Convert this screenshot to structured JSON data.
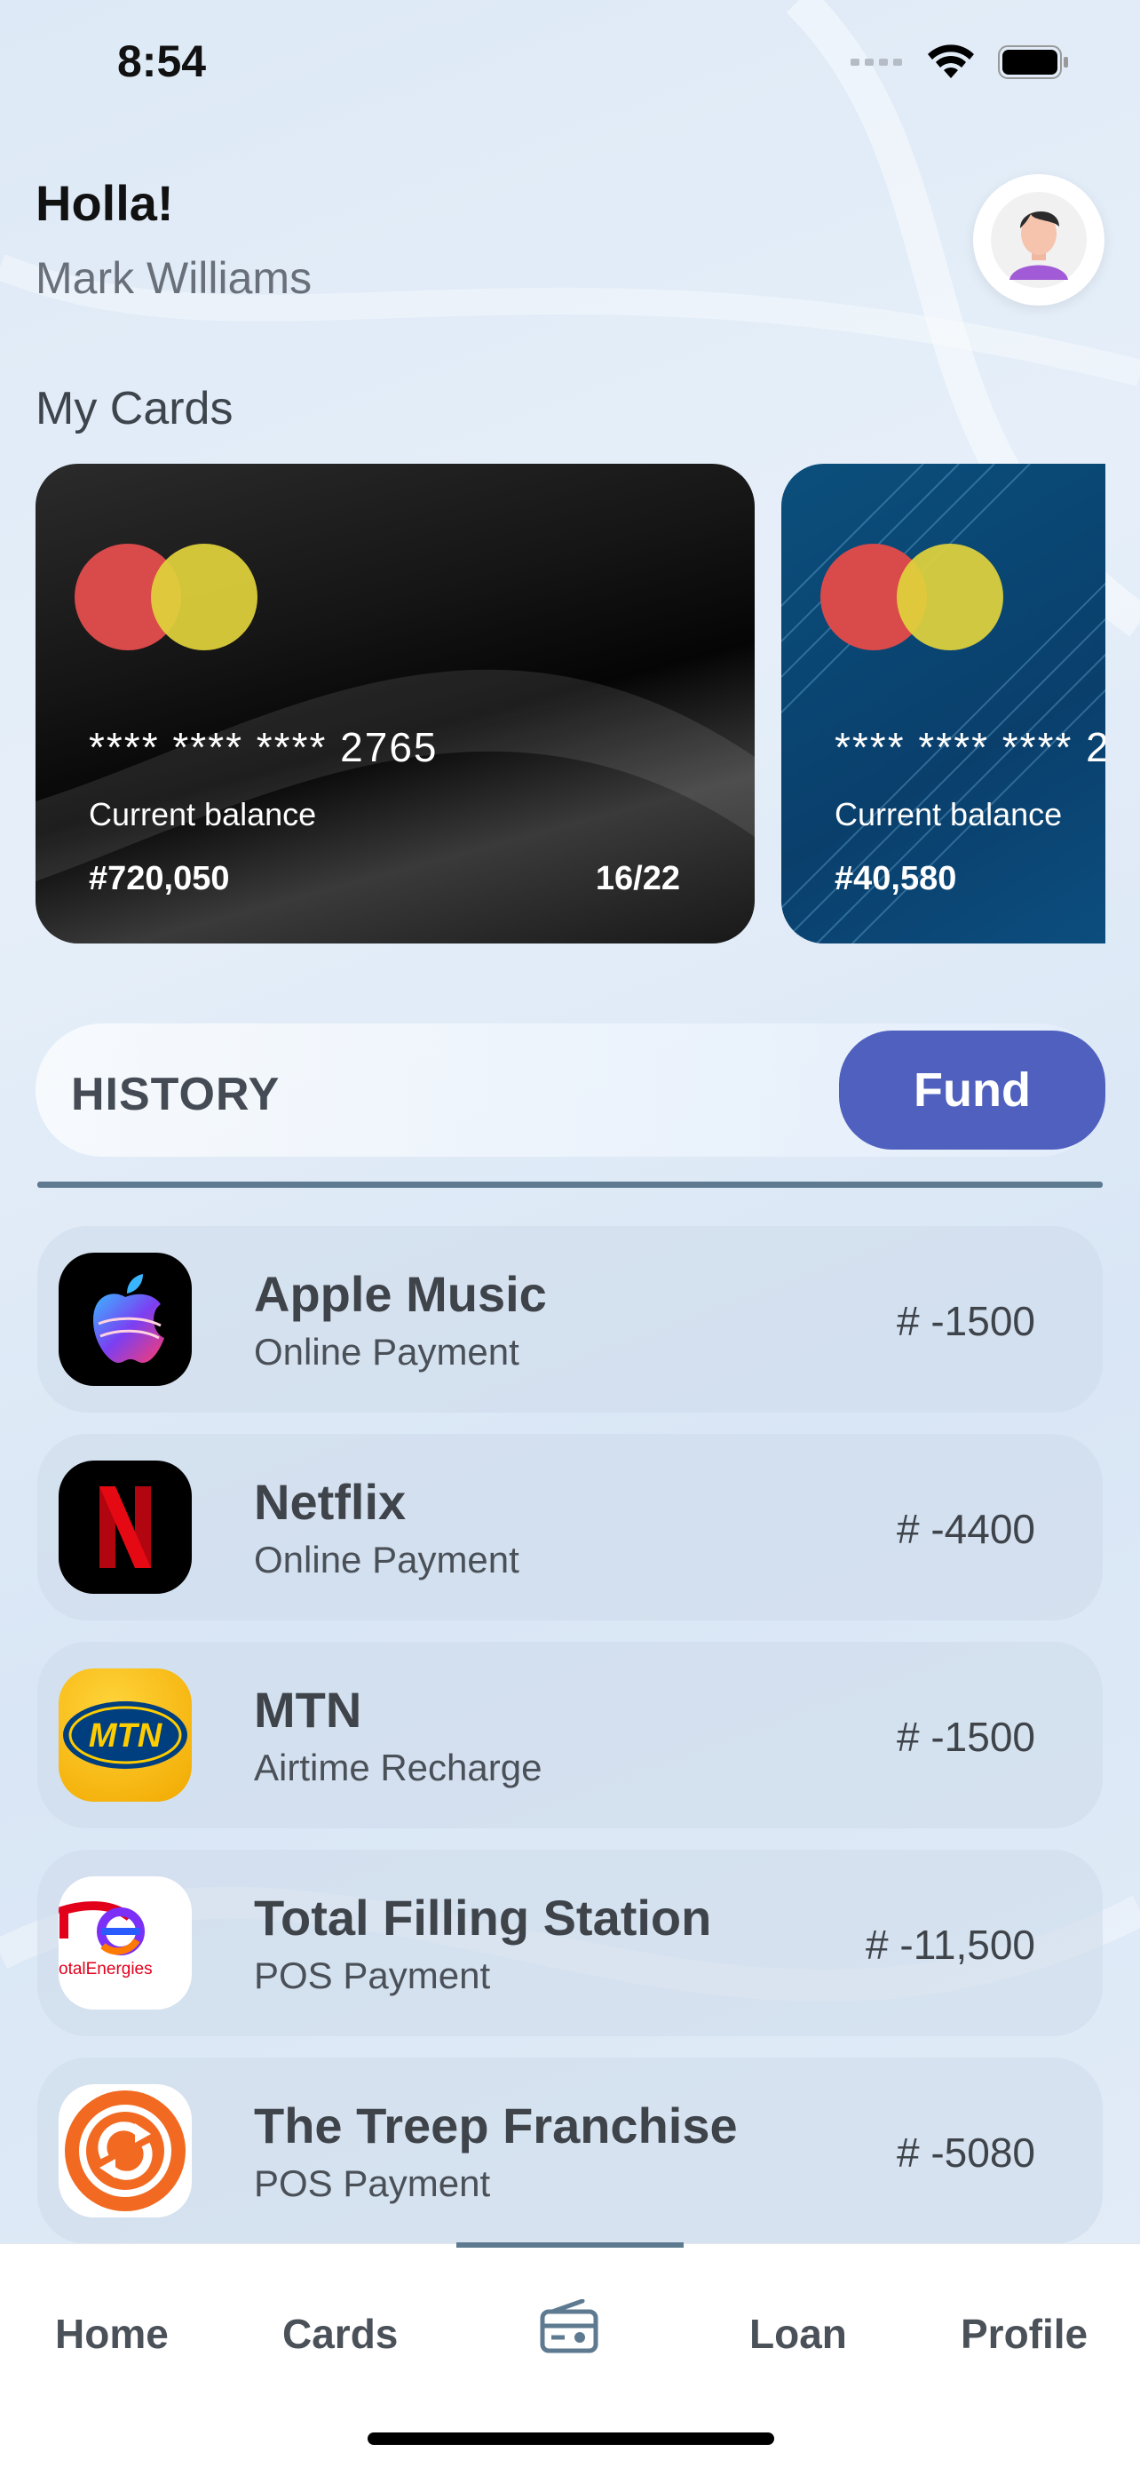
{
  "status_bar": {
    "time": "8:54"
  },
  "header": {
    "greeting": "Holla!",
    "user_name": "Mark Williams"
  },
  "cards_section": {
    "title": "My Cards"
  },
  "cards": [
    {
      "number": "**** **** **** 2765",
      "balance_label": "Current balance",
      "balance": "#720,050",
      "expiry": "16/22",
      "style": "black"
    },
    {
      "number": "**** **** **** 2",
      "balance_label": "Current balance",
      "balance": "#40,580",
      "style": "blue"
    }
  ],
  "history": {
    "label": "HISTORY",
    "fund_label": "Fund"
  },
  "transactions": [
    {
      "title": "Apple Music",
      "subtitle": "Online Payment",
      "amount": "# -1500",
      "icon": "apple-music-icon"
    },
    {
      "title": "Netflix",
      "subtitle": "Online Payment",
      "amount": "# -4400",
      "icon": "netflix-icon"
    },
    {
      "title": "MTN",
      "subtitle": "Airtime Recharge",
      "amount": "# -1500",
      "icon": "mtn-icon"
    },
    {
      "title": "Total Filling Station",
      "subtitle": "POS Payment",
      "amount": "# -11,500",
      "icon": "totalenergies-icon",
      "icon_text": "otalEnergies"
    },
    {
      "title": "The Treep Franchise",
      "subtitle": "POS Payment",
      "amount": "# -5080",
      "icon": "treep-icon"
    }
  ],
  "tab_bar": {
    "items": [
      {
        "label": "Home"
      },
      {
        "label": "Cards"
      },
      {
        "label": "",
        "icon": "radio-icon",
        "active": true
      },
      {
        "label": "Loan"
      },
      {
        "label": "Profile"
      }
    ]
  },
  "colors": {
    "accent": "#4f60be",
    "divider": "#5e7a90",
    "mastercard_red": "#d94a4a",
    "mastercard_yellow": "#e0d23c"
  }
}
